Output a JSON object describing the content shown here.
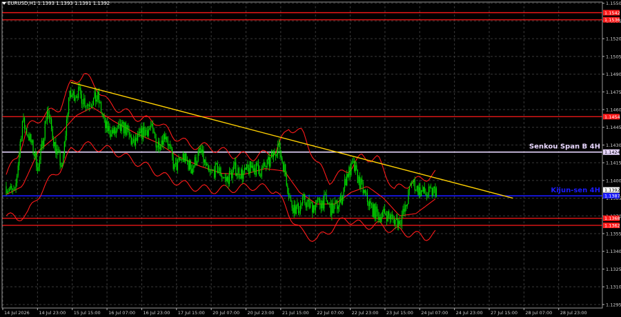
{
  "header": {
    "symbol_info": "EURUSD,H1  1.1393 1.1393 1.1391 1.1392"
  },
  "chart_data": {
    "type": "candlestick",
    "symbol": "EURUSD",
    "timeframe": "H1",
    "ohlc": {
      "open": 1.1393,
      "high": 1.1393,
      "low": 1.1391,
      "close": 1.1392
    },
    "ylim": [
      1.1292,
      1.1551
    ],
    "price_ticks": [
      "1.1550",
      "1.1535",
      "1.1520",
      "1.1505",
      "1.1490",
      "1.1475",
      "1.1460",
      "1.1445",
      "1.1430",
      "1.1415",
      "1.1400",
      "1.1385",
      "1.1370",
      "1.1355",
      "1.1340",
      "1.1325",
      "1.1310",
      "1.1295"
    ],
    "time_ticks": [
      "14 Jul 2026",
      "14 Jul 23:00",
      "15 Jul 15:00",
      "16 Jul 07:00",
      "16 Jul 23:00",
      "17 Jul 15:00",
      "20 Jul 07:00",
      "20 Jul 23:00",
      "21 Jul 15:00",
      "22 Jul 07:00",
      "22 Jul 23:00",
      "23 Jul 15:00",
      "24 Jul 07:00",
      "24 Jul 23:00",
      "27 Jul 15:00",
      "28 Jul 07:00",
      "28 Jul 23:00"
    ],
    "grid": true,
    "colors": {
      "background": "#000000",
      "grid": "#3a3a3a",
      "candles": "#00e000",
      "indicator": "#ff1a1a",
      "trendline": "#ffd000",
      "senkou": "#e9d7ff",
      "kijun": "#1a1aff",
      "current_price_label": "#ffffff"
    },
    "horizontal_levels": [
      {
        "price": 1.1542,
        "label": "1.1542",
        "color": "#ff1a1a"
      },
      {
        "price": 1.1536,
        "label": "1.1536",
        "color": "#ff1a1a"
      },
      {
        "price": 1.1454,
        "label": "1.1454",
        "color": "#ff1a1a"
      },
      {
        "price": 1.1424,
        "label": "1.1424",
        "color": "#e9d7ff",
        "name": "Senkou Span B 4H"
      },
      {
        "price": 1.1387,
        "label": "1.1387",
        "color": "#1a1aff",
        "name": "Kijun-sen 4H"
      },
      {
        "price": 1.1368,
        "label": "1.1368",
        "color": "#ff1a1a"
      },
      {
        "price": 1.1362,
        "label": "1.1362",
        "color": "#ff1a1a"
      }
    ],
    "current_price": {
      "price": 1.1392,
      "label": "1.1392"
    },
    "trendline": {
      "start": {
        "bar": 60,
        "price": 1.1483
      },
      "end": {
        "bar": 470,
        "price": 1.1385
      }
    },
    "bars_count": 400,
    "close_path": [
      [
        0,
        1.1395
      ],
      [
        8,
        1.1388
      ],
      [
        15,
        1.145
      ],
      [
        22,
        1.1435
      ],
      [
        30,
        1.141
      ],
      [
        38,
        1.146
      ],
      [
        45,
        1.143
      ],
      [
        52,
        1.141
      ],
      [
        58,
        1.147
      ],
      [
        66,
        1.1475
      ],
      [
        75,
        1.1465
      ],
      [
        85,
        1.147
      ],
      [
        92,
        1.1445
      ],
      [
        100,
        1.144
      ],
      [
        110,
        1.1445
      ],
      [
        118,
        1.143
      ],
      [
        126,
        1.144
      ],
      [
        134,
        1.1445
      ],
      [
        140,
        1.143
      ],
      [
        148,
        1.144
      ],
      [
        156,
        1.141
      ],
      [
        164,
        1.142
      ],
      [
        172,
        1.141
      ],
      [
        180,
        1.1425
      ],
      [
        188,
        1.1405
      ],
      [
        196,
        1.141
      ],
      [
        204,
        1.14
      ],
      [
        212,
        1.141
      ],
      [
        220,
        1.1405
      ],
      [
        228,
        1.1412
      ],
      [
        236,
        1.1408
      ],
      [
        244,
        1.1415
      ],
      [
        252,
        1.143
      ],
      [
        258,
        1.141
      ],
      [
        264,
        1.138
      ],
      [
        270,
        1.1375
      ],
      [
        276,
        1.1383
      ],
      [
        282,
        1.1378
      ],
      [
        288,
        1.138
      ],
      [
        296,
        1.1383
      ],
      [
        302,
        1.1375
      ],
      [
        310,
        1.1382
      ],
      [
        316,
        1.1405
      ],
      [
        322,
        1.1412
      ],
      [
        328,
        1.1398
      ],
      [
        334,
        1.1385
      ],
      [
        340,
        1.1375
      ],
      [
        346,
        1.137
      ],
      [
        352,
        1.1372
      ],
      [
        358,
        1.1368
      ],
      [
        364,
        1.1365
      ],
      [
        370,
        1.1375
      ],
      [
        376,
        1.14
      ],
      [
        382,
        1.1392
      ],
      [
        390,
        1.1388
      ],
      [
        399,
        1.1392
      ]
    ],
    "indicator_bands": {
      "upper": [
        [
          0,
          1.1405
        ],
        [
          10,
          1.142
        ],
        [
          20,
          1.1445
        ],
        [
          35,
          1.1455
        ],
        [
          50,
          1.1462
        ],
        [
          60,
          1.1482
        ],
        [
          72,
          1.149
        ],
        [
          85,
          1.1478
        ],
        [
          95,
          1.1465
        ],
        [
          110,
          1.1458
        ],
        [
          125,
          1.1452
        ],
        [
          140,
          1.145
        ],
        [
          155,
          1.1438
        ],
        [
          170,
          1.143
        ],
        [
          190,
          1.1428
        ],
        [
          210,
          1.1422
        ],
        [
          230,
          1.142
        ],
        [
          250,
          1.1425
        ],
        [
          262,
          1.1445
        ],
        [
          275,
          1.144
        ],
        [
          288,
          1.1415
        ],
        [
          300,
          1.14
        ],
        [
          315,
          1.1408
        ],
        [
          330,
          1.142
        ],
        [
          345,
          1.1418
        ],
        [
          360,
          1.1392
        ],
        [
          375,
          1.1398
        ],
        [
          388,
          1.1402
        ],
        [
          399,
          1.1406
        ]
      ],
      "lower": [
        [
          0,
          1.137
        ],
        [
          10,
          1.1368
        ],
        [
          20,
          1.1372
        ],
        [
          35,
          1.1395
        ],
        [
          50,
          1.141
        ],
        [
          60,
          1.1425
        ],
        [
          72,
          1.143
        ],
        [
          85,
          1.1428
        ],
        [
          100,
          1.1425
        ],
        [
          115,
          1.1418
        ],
        [
          130,
          1.1412
        ],
        [
          150,
          1.1402
        ],
        [
          170,
          1.1395
        ],
        [
          190,
          1.1392
        ],
        [
          210,
          1.1393
        ],
        [
          230,
          1.1395
        ],
        [
          250,
          1.1392
        ],
        [
          262,
          1.1372
        ],
        [
          275,
          1.1355
        ],
        [
          288,
          1.135
        ],
        [
          300,
          1.1358
        ],
        [
          315,
          1.1368
        ],
        [
          330,
          1.1362
        ],
        [
          345,
          1.1362
        ],
        [
          360,
          1.1358
        ],
        [
          375,
          1.1355
        ],
        [
          388,
          1.1352
        ],
        [
          399,
          1.1355
        ]
      ],
      "middle": [
        [
          0,
          1.1388
        ],
        [
          15,
          1.1395
        ],
        [
          30,
          1.1425
        ],
        [
          50,
          1.144
        ],
        [
          65,
          1.1455
        ],
        [
          80,
          1.1462
        ],
        [
          100,
          1.145
        ],
        [
          120,
          1.144
        ],
        [
          140,
          1.1432
        ],
        [
          160,
          1.142
        ],
        [
          180,
          1.1412
        ],
        [
          200,
          1.1406
        ],
        [
          220,
          1.1405
        ],
        [
          240,
          1.141
        ],
        [
          258,
          1.1408
        ],
        [
          272,
          1.139
        ],
        [
          288,
          1.138
        ],
        [
          305,
          1.138
        ],
        [
          320,
          1.139
        ],
        [
          335,
          1.1395
        ],
        [
          350,
          1.1385
        ],
        [
          365,
          1.137
        ],
        [
          380,
          1.1372
        ],
        [
          399,
          1.1385
        ]
      ]
    }
  }
}
